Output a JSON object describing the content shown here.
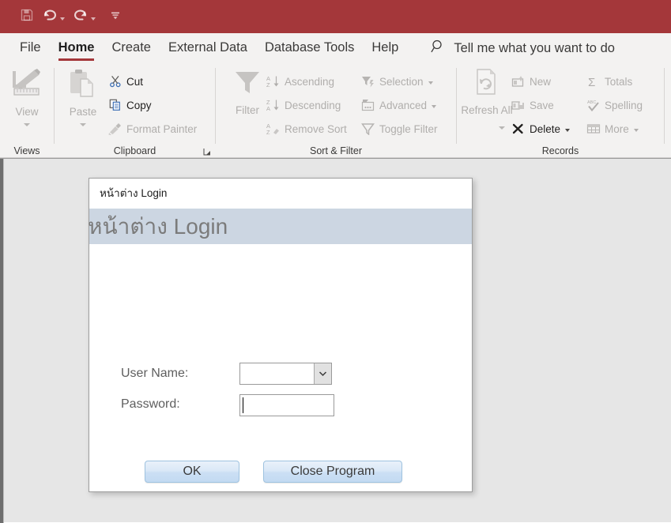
{
  "quick_access": {
    "items": [
      {
        "name": "save",
        "label": "Save",
        "icon": "floppy-disk-icon",
        "enabled": false,
        "has_dropdown": false
      },
      {
        "name": "undo",
        "label": "Undo",
        "icon": "undo-arrow-icon",
        "enabled": true,
        "has_dropdown": true
      },
      {
        "name": "redo",
        "label": "Redo",
        "icon": "redo-arrow-icon",
        "enabled": true,
        "has_dropdown": true
      },
      {
        "name": "customize",
        "label": "Customize Quick Access Toolbar",
        "icon": "customize-qat-icon",
        "enabled": true,
        "has_dropdown": false
      }
    ],
    "background_color": "#a4373a"
  },
  "ribbon": {
    "tabs": [
      {
        "label": "File",
        "active": false
      },
      {
        "label": "Home",
        "active": true
      },
      {
        "label": "Create",
        "active": false
      },
      {
        "label": "External Data",
        "active": false
      },
      {
        "label": "Database Tools",
        "active": false
      },
      {
        "label": "Help",
        "active": false
      }
    ],
    "active_tab_underline_color": "#a4373a",
    "tell_me": {
      "icon": "search-icon",
      "text": "Tell me what you want to do"
    },
    "groups": [
      {
        "name": "views",
        "label": "Views",
        "big_button": {
          "label": "View",
          "icon": "view-design-icon",
          "enabled": false,
          "has_dropdown": true
        }
      },
      {
        "name": "clipboard",
        "label": "Clipboard",
        "has_dialog_launcher": true,
        "big_button": {
          "label": "Paste",
          "icon": "paste-clipboard-icon",
          "enabled": false,
          "has_dropdown": true
        },
        "items": [
          {
            "label": "Cut",
            "icon": "scissors-icon",
            "enabled": true
          },
          {
            "label": "Copy",
            "icon": "copy-pages-icon",
            "enabled": true
          },
          {
            "label": "Format Painter",
            "icon": "paintbrush-icon",
            "enabled": false
          }
        ]
      },
      {
        "name": "sort-and-filter",
        "label": "Sort & Filter",
        "big_button": {
          "label": "Filter",
          "icon": "funnel-icon",
          "enabled": false,
          "has_dropdown": false
        },
        "items": [
          {
            "label": "Ascending",
            "icon": "sort-ascending-icon",
            "enabled": false
          },
          {
            "label": "Descending",
            "icon": "sort-descending-icon",
            "enabled": false
          },
          {
            "label": "Remove Sort",
            "icon": "remove-sort-icon",
            "enabled": false
          },
          {
            "label": "Selection",
            "icon": "selection-filter-icon",
            "enabled": false,
            "has_dropdown": true
          },
          {
            "label": "Advanced",
            "icon": "advanced-filter-icon",
            "enabled": false,
            "has_dropdown": true
          },
          {
            "label": "Toggle Filter",
            "icon": "toggle-filter-icon",
            "enabled": false
          }
        ]
      },
      {
        "name": "records",
        "label": "Records",
        "big_button": {
          "label": "Refresh All",
          "icon": "refresh-all-icon",
          "enabled": false,
          "has_dropdown": true
        },
        "items": [
          {
            "label": "New",
            "icon": "new-record-icon",
            "enabled": false
          },
          {
            "label": "Save",
            "icon": "save-record-icon",
            "enabled": false
          },
          {
            "label": "Delete",
            "icon": "delete-x-icon",
            "enabled": true,
            "has_dropdown": true
          },
          {
            "label": "Totals",
            "icon": "sigma-totals-icon",
            "enabled": false
          },
          {
            "label": "Spelling",
            "icon": "spelling-check-icon",
            "enabled": false
          },
          {
            "label": "More",
            "icon": "more-grid-icon",
            "enabled": false,
            "has_dropdown": true
          }
        ]
      }
    ]
  },
  "form_window": {
    "tab_title": "หน้าต่าง Login",
    "header_title": "หน้าต่าง Login",
    "header_background": "#ccd6e2",
    "fields": [
      {
        "name": "user-name",
        "label": "User Name:",
        "type": "combobox",
        "value": "",
        "focused": false
      },
      {
        "name": "password",
        "label": "Password:",
        "type": "textbox",
        "value": "",
        "focused": true
      }
    ],
    "buttons": [
      {
        "name": "ok",
        "label": "OK"
      },
      {
        "name": "close-program",
        "label": "Close Program"
      }
    ]
  }
}
